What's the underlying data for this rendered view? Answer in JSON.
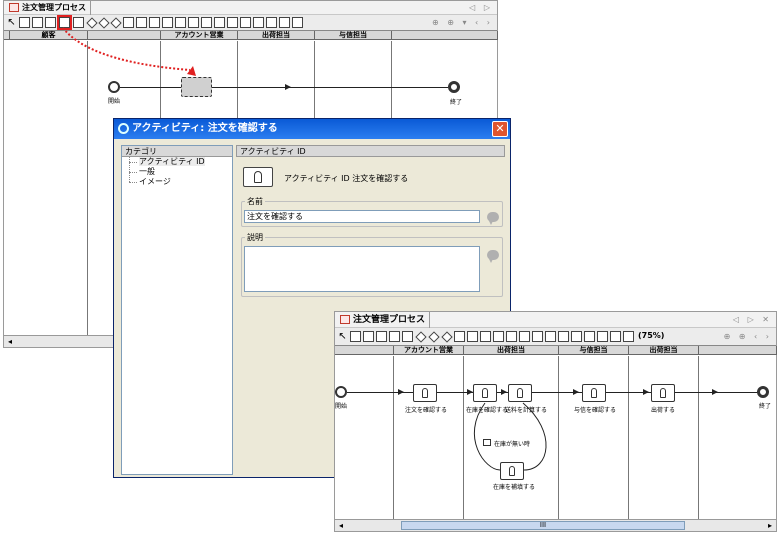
{
  "back_window": {
    "tab_title": "注文管理プロセス",
    "lanes": [
      "顧客",
      "アカウント営業",
      "出荷担当",
      "与信担当"
    ],
    "start_label": "開始",
    "end_label": "終了"
  },
  "dialog": {
    "title": "アクティビティ: 注文を確認する",
    "close_glyph": "✕",
    "category_header": "カテゴリ",
    "tree_items": [
      "アクティビティ ID",
      "一般",
      "イメージ"
    ],
    "panel_header": "アクティビティ ID",
    "activity_id_label": "アクティビティ ID",
    "activity_id_value": "注文を確認する",
    "name_group_label": "名前",
    "name_value": "注文を確認する",
    "description_group_label": "説明",
    "description_value": ""
  },
  "front_window": {
    "tab_title": "注文管理プロセス",
    "zoom_label": "(75%)",
    "lanes": [
      "アカウント営業",
      "出荷担当",
      "与信担当",
      "出荷担当"
    ],
    "start_label": "開始",
    "end_label": "終了",
    "activities": [
      "注文を確認する",
      "在庫を確認する",
      "送料を計算する",
      "与信を確認する",
      "出荷する",
      "在庫を補填する"
    ],
    "condition_label": "在庫が無い時",
    "scroll_thumb_glyph": "III"
  },
  "colors": {
    "annotation_red": "#e02020",
    "dialog_title_bg": "#0a5ad6",
    "dialog_bg": "#ece9d8"
  }
}
